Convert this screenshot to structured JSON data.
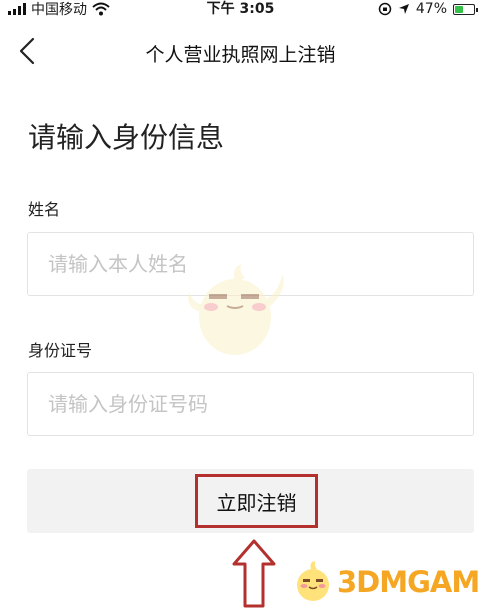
{
  "status_bar": {
    "carrier": "中国移动",
    "time": "下午 3:05",
    "battery_text": "47%",
    "battery_level": 0.47
  },
  "nav": {
    "title": "个人营业执照网上注销"
  },
  "form": {
    "heading": "请输入身份信息",
    "name_label": "姓名",
    "name_placeholder": "请输入本人姓名",
    "id_label": "身份证号",
    "id_placeholder": "请输入身份证号码",
    "submit_label": "立即注销"
  },
  "watermark": {
    "text": "3DMGAME"
  },
  "colors": {
    "highlight_box": "#b3302e",
    "battery": "#35c04a",
    "watermark": "#f5a623"
  }
}
